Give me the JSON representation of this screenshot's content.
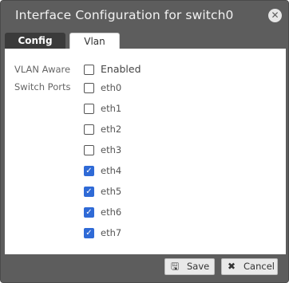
{
  "dialog": {
    "title": "Interface Configuration for switch0",
    "close_icon": "close-icon",
    "tabs": [
      {
        "label": "Config",
        "active": false
      },
      {
        "label": "Vlan",
        "active": true
      }
    ]
  },
  "vlan": {
    "vlan_aware_label": "VLAN Aware",
    "enabled_label": "Enabled",
    "enabled_checked": false,
    "switch_ports_label": "Switch Ports",
    "ports": [
      {
        "name": "eth0",
        "checked": false
      },
      {
        "name": "eth1",
        "checked": false
      },
      {
        "name": "eth2",
        "checked": false
      },
      {
        "name": "eth3",
        "checked": false
      },
      {
        "name": "eth4",
        "checked": true
      },
      {
        "name": "eth5",
        "checked": true
      },
      {
        "name": "eth6",
        "checked": true
      },
      {
        "name": "eth7",
        "checked": true
      }
    ]
  },
  "footer": {
    "save_label": "Save",
    "save_icon": "save-icon",
    "cancel_label": "Cancel",
    "cancel_icon": "cancel-icon"
  },
  "colors": {
    "dialog_bg": "#5d5d5d",
    "active_tab_bg": "#3b3b3b",
    "checkbox_checked": "#2f6ad6"
  }
}
